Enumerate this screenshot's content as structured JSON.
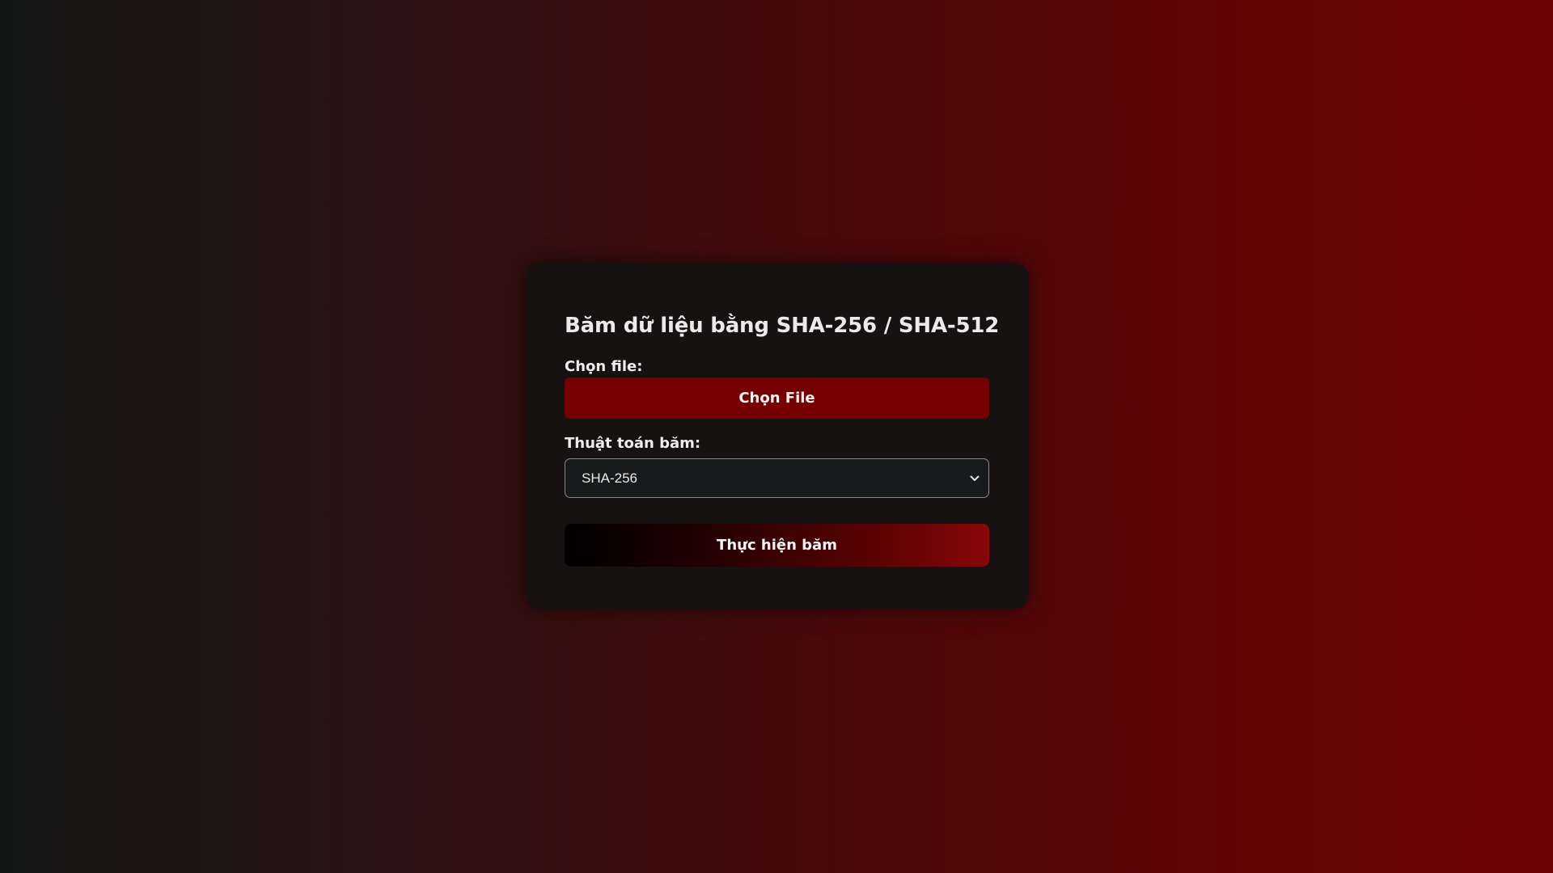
{
  "form": {
    "title": "Băm dữ liệu bằng SHA-256 / SHA-512",
    "file_label": "Chọn file:",
    "file_button_label": "Chọn File",
    "algorithm_label": "Thuật toán băm:",
    "algorithm_selected": "SHA-256",
    "submit_label": "Thực hiện băm"
  },
  "icons": {
    "select_arrow": "chevron-down-icon"
  },
  "colors": {
    "background_left": "#141616",
    "background_right": "#6e0204",
    "card_background": "#161212",
    "file_button": "#760000",
    "select_background": "#181a1b",
    "submit_gradient_start": "#000000",
    "submit_gradient_end": "#880709"
  }
}
